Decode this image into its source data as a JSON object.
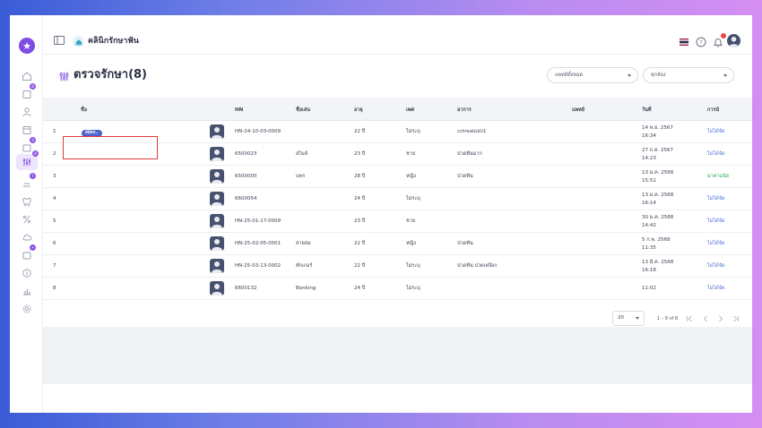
{
  "header": {
    "clinic_name": "คลินิกรักษาฟัน"
  },
  "page": {
    "title": "ตรวจรักษา(8)"
  },
  "filters": {
    "doctor": "แพทย์ทั้งหมด",
    "room": "ทุกห้อง"
  },
  "sidebar": {
    "badges": [
      "8",
      "3",
      "8",
      "7",
      "•"
    ]
  },
  "table": {
    "columns": {
      "name": "ชื่อ",
      "hn": "HN",
      "nickname": "ชื่อเล่น",
      "age": "อายุ",
      "sex": "เพศ",
      "symptom": "อาการ",
      "doctor": "แพทย์",
      "date": "วันที่",
      "payment": "การนั"
    },
    "rows": [
      {
        "no": "1",
        "name": "",
        "tag": "สมัคร..",
        "hn": "HN-24-10-03-0009",
        "nickname": "",
        "age": "22 ปี",
        "sex": "ไม่ระบุ",
        "symptom": "cctrealแอบ1",
        "doctor": "",
        "date1": "14 พ.ย. 2567",
        "date2": "16:34",
        "payment": "ไม่ได้จัด",
        "paid": false
      },
      {
        "no": "2",
        "name": "",
        "tag": "",
        "hn": "6500023",
        "nickname": "สไมล์",
        "age": "23 ปี",
        "sex": "ชาย",
        "symptom": "ปวดฟันมาก",
        "doctor": "",
        "date1": "27 ธ.ค. 2567",
        "date2": "14:23",
        "payment": "ไม่ได้จัด",
        "paid": false
      },
      {
        "no": "3",
        "name": "",
        "tag": "",
        "hn": "6500000",
        "nickname": "แพร",
        "age": "28 ปี",
        "sex": "หญิง",
        "symptom": "ปวดฟัน",
        "doctor": "",
        "date1": "13 ม.ค. 2568",
        "date2": "15:51",
        "payment": "มาตามนัด",
        "paid": true
      },
      {
        "no": "4",
        "name": "",
        "tag": "",
        "hn": "6600054",
        "nickname": "",
        "age": "24 ปี",
        "sex": "ไม่ระบุ",
        "symptom": "",
        "doctor": "",
        "date1": "13 ม.ค. 2568",
        "date2": "16:14",
        "payment": "ไม่ได้จัด",
        "paid": false
      },
      {
        "no": "5",
        "name": "",
        "tag": "",
        "hn": "HN-25-01-17-0009",
        "nickname": "",
        "age": "23 ปี",
        "sex": "ชาย",
        "symptom": "",
        "doctor": "",
        "date1": "30 ม.ค. 2568",
        "date2": "14:42",
        "payment": "ไม่ได้จัด",
        "paid": false
      },
      {
        "no": "6",
        "name": "",
        "tag": "",
        "hn": "HN-25-02-05-0001",
        "nickname": "สายลม",
        "age": "22 ปี",
        "sex": "หญิง",
        "symptom": "ปวดฟัน",
        "doctor": "",
        "date1": "5 ก.พ. 2568",
        "date2": "11:35",
        "payment": "ไม่ได้จัด",
        "paid": false
      },
      {
        "no": "7",
        "name": "",
        "tag": "",
        "hn": "HN-25-03-13-0002",
        "nickname": "ทักเกอร์",
        "age": "22 ปี",
        "sex": "ไม่ระบุ",
        "symptom": "ปวดฟัน ปวดเหงือก",
        "doctor": "",
        "date1": "13 มี.ค. 2568",
        "date2": "16:18",
        "payment": "ไม่ได้จัด",
        "paid": false
      },
      {
        "no": "8",
        "name": "",
        "tag": "",
        "hn": "6600132",
        "nickname": "Bonking",
        "age": "24 ปี",
        "sex": "ไม่ระบุ",
        "symptom": "",
        "doctor": "",
        "date1": "11:02",
        "date2": "",
        "payment": "ไม่ได้จัด",
        "paid": false
      }
    ]
  },
  "pagination": {
    "page_size": "20",
    "range": "1 – 8 of 8"
  },
  "colors": {
    "accent": "#7c4de0",
    "tag": "#4e62cc",
    "link": "#4f6fd8",
    "success": "#2eaa5a",
    "highlight": "#e23b3b"
  }
}
